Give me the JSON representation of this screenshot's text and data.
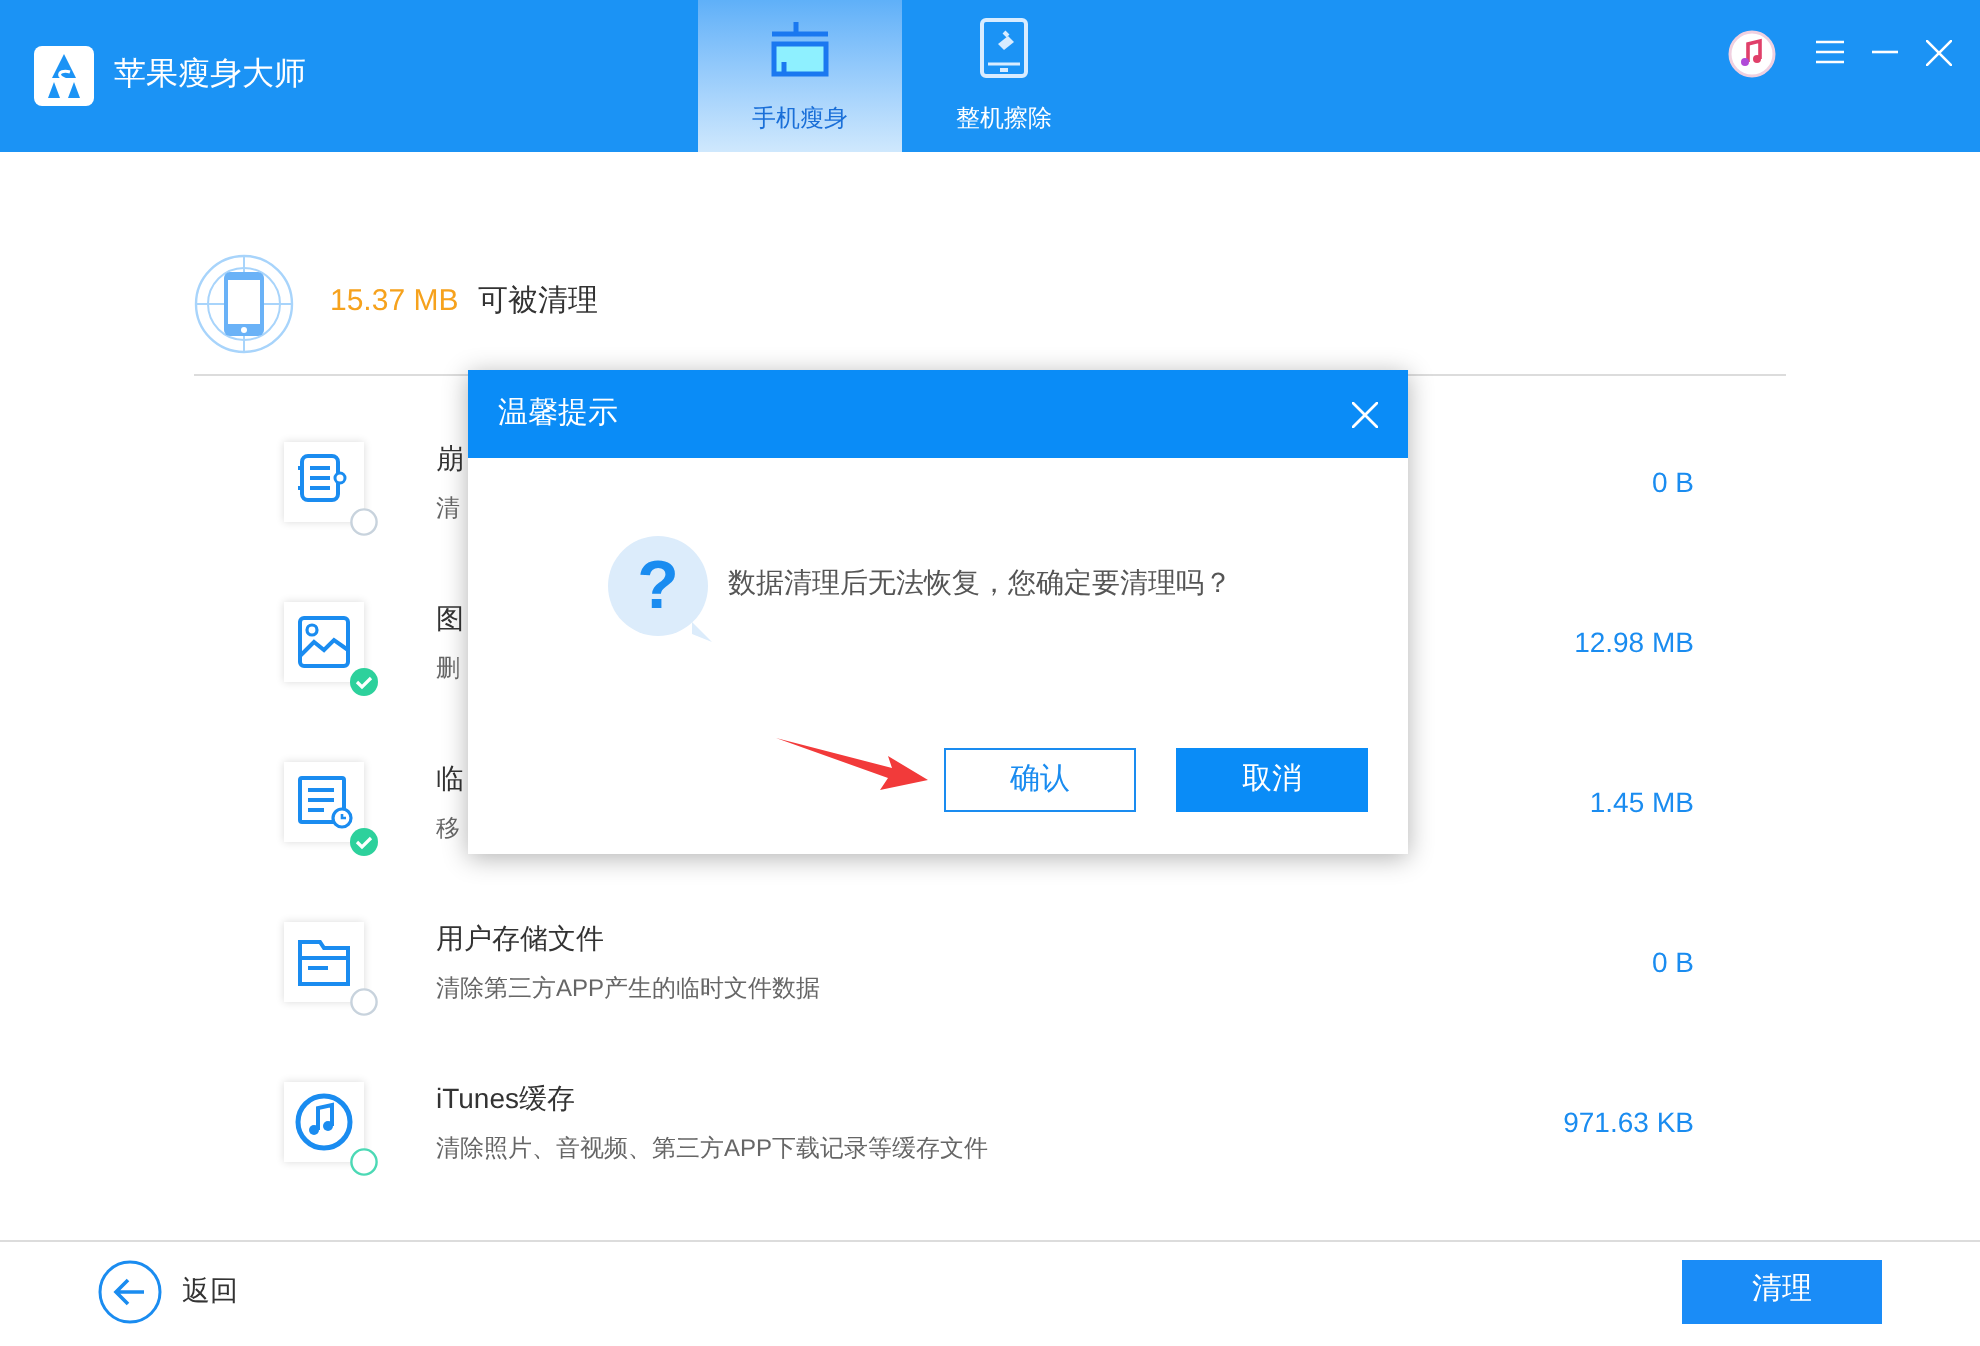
{
  "app": {
    "title": "苹果瘦身大师"
  },
  "tabs": [
    {
      "label": "手机瘦身",
      "kind": "broom",
      "selected": true
    },
    {
      "label": "整机擦除",
      "kind": "tablet",
      "selected": false
    }
  ],
  "summary": {
    "size": "15.37 MB",
    "label": "可被清理"
  },
  "items": [
    {
      "kind": "log",
      "title": "崩",
      "description": "清",
      "size": "0 B",
      "checked": false,
      "hovered": false
    },
    {
      "kind": "image",
      "title": "图",
      "description": "删",
      "size": "12.98 MB",
      "checked": true,
      "hovered": false
    },
    {
      "kind": "temp",
      "title": "临",
      "description": "移",
      "size": "1.45 MB",
      "checked": true,
      "hovered": false
    },
    {
      "kind": "folder",
      "title": "用户存储文件",
      "description": "清除第三方APP产生的临时文件数据",
      "size": "0 B",
      "checked": false,
      "hovered": false
    },
    {
      "kind": "music",
      "title": "iTunes缓存",
      "description": "清除照片、音视频、第三方APP下载记录等缓存文件",
      "size": "971.63 KB",
      "checked": false,
      "hovered": true
    }
  ],
  "footer": {
    "back": "返回",
    "clean": "清理"
  },
  "dialog": {
    "title": "温馨提示",
    "message": "数据清理后无法恢复，您确定要清理吗？",
    "question_mark": "?",
    "buttons": [
      {
        "label": "确认",
        "kind": "outline"
      },
      {
        "label": "取消",
        "kind": "primary"
      }
    ]
  }
}
